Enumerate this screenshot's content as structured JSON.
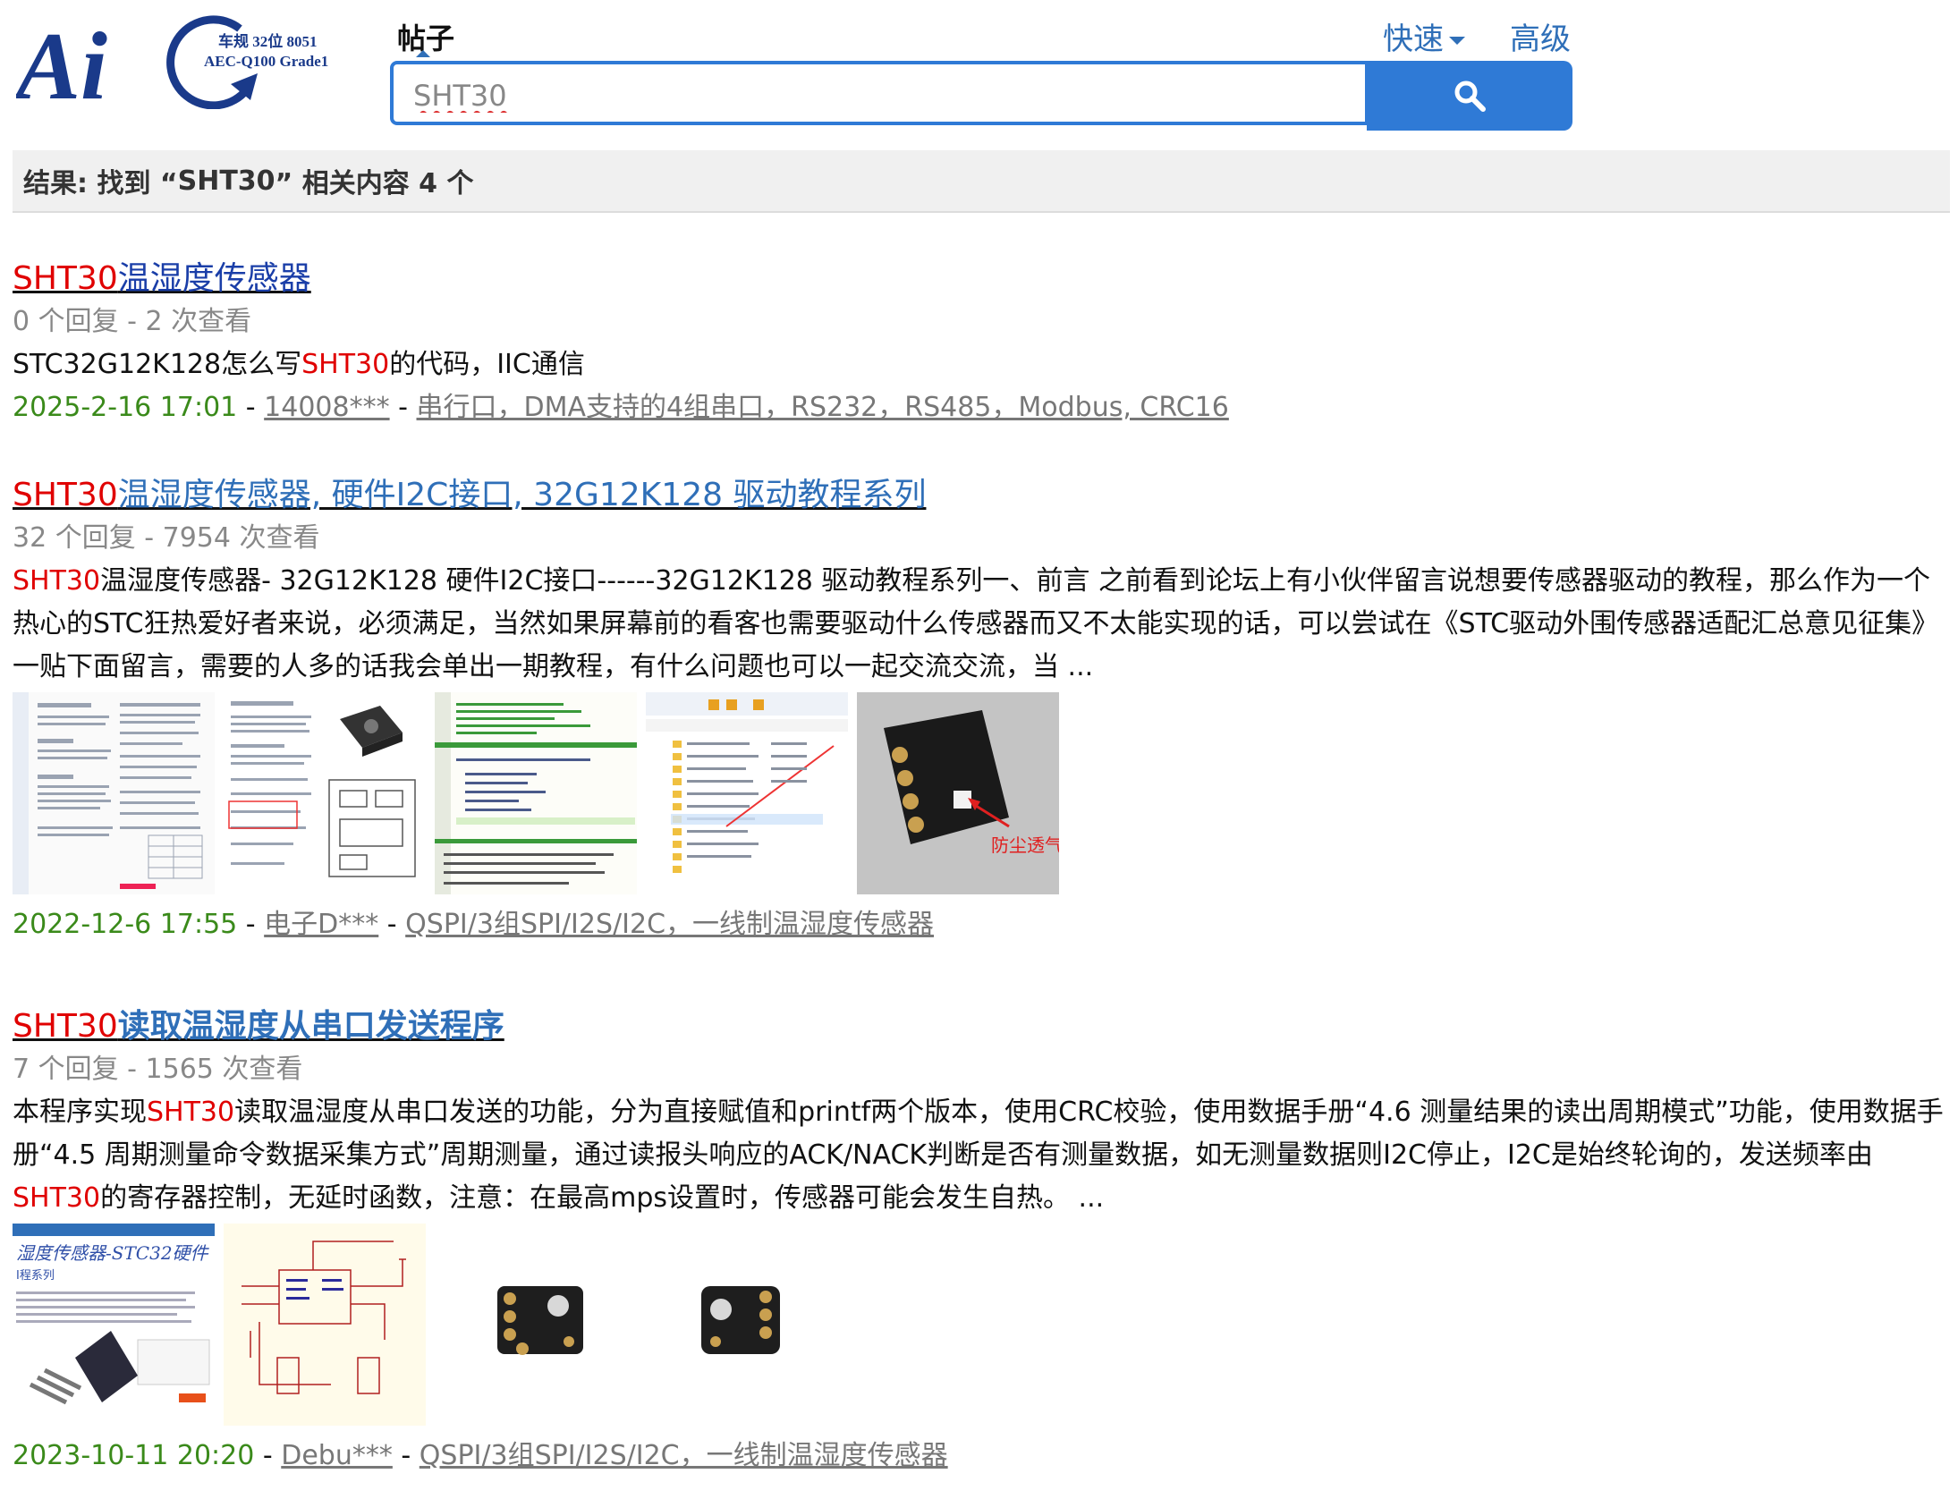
{
  "logo": {
    "main_text": "Ai",
    "line1": "车规 32位 8051",
    "line2": "AEC-Q100 Grade1"
  },
  "search": {
    "active_tab": "帖子",
    "query": "SHT30",
    "quick_label": "快速",
    "advanced_label": "高级",
    "search_icon": "search-icon"
  },
  "results_summary": {
    "prefix": "结果: 找到 “",
    "term": "SHT30",
    "suffix": "” 相关内容 4 个"
  },
  "results": [
    {
      "title_hl": "SHT30",
      "title_rest": "温湿度传感器",
      "replies": "0 个回复",
      "views": "2 次查看",
      "desc_parts": [
        "STC32G12K128怎么写",
        "SHT30",
        "的代码，IIC通信"
      ],
      "date": "2025-2-16 17:01",
      "author": "14008***",
      "forum": "串行口，DMA支持的4组串口，RS232，RS485，Modbus, CRC16"
    },
    {
      "title_hl": "SHT30",
      "title_rest": "温湿度传感器, 硬件I2C接口, 32G12K128 驱动教程系列",
      "replies": "32 个回复",
      "views": "7954 次查看",
      "desc_hl": "SHT30",
      "desc_rest": "温湿度传感器- 32G12K128 硬件I2C接口------32G12K128 驱动教程系列一、前言 之前看到论坛上有小伙伴留言说想要传感器驱动的教程，那么作为一个热心的STC狂热爱好者来说，必须满足，当然如果屏幕前的看客也需要驱动什么传感器而又不太能实现的话，可以尝试在《STC驱动外围传感器适配汇总意见征集》一贴下面留言，需要的人多的话我会单出一期教程，有什么问题也可以一起交流交流，当 ...",
      "thumb_caption": "防尘透气",
      "date": "2022-12-6 17:55",
      "author": "电子D***",
      "forum": "QSPI/3组SPI/I2S/I2C，一线制温湿度传感器"
    },
    {
      "title_hl": "SHT30",
      "title_rest": "读取温湿度从串口发送程序",
      "replies": "7 个回复",
      "views": "1565 次查看",
      "desc_a": "本程序实现",
      "desc_hl1": "SHT30",
      "desc_b": "读取温湿度从串口发送的功能，分为直接赋值和printf两个版本，使用CRC校验，使用数据手册“4.6 测量结果的读出周期模式”功能，使用数据手册“4.5 周期测量命令数据采集方式”周期测量，通过读报头响应的ACK/NACK判断是否有测量数据，如无测量数据则I2C停止，I2C是始终轮询的，发送频率由",
      "desc_hl2": "SHT30",
      "desc_c": "的寄存器控制，无延时函数，注意：在最高mps设置时，传感器可能会发生自热。 ...",
      "thumb_header": "湿度传感器-STC32硬件",
      "thumb_sub": "I程系列",
      "date": "2023-10-11 20:20",
      "author": "Debu***",
      "forum": "QSPI/3组SPI/I2S/I2C，一线制温湿度传感器"
    }
  ],
  "colors": {
    "accent": "#2f7ad6",
    "highlight": "#e00000",
    "date": "#3a8a1a",
    "title_dark": "#1a3ea8",
    "title_light": "#2f6fb8"
  }
}
